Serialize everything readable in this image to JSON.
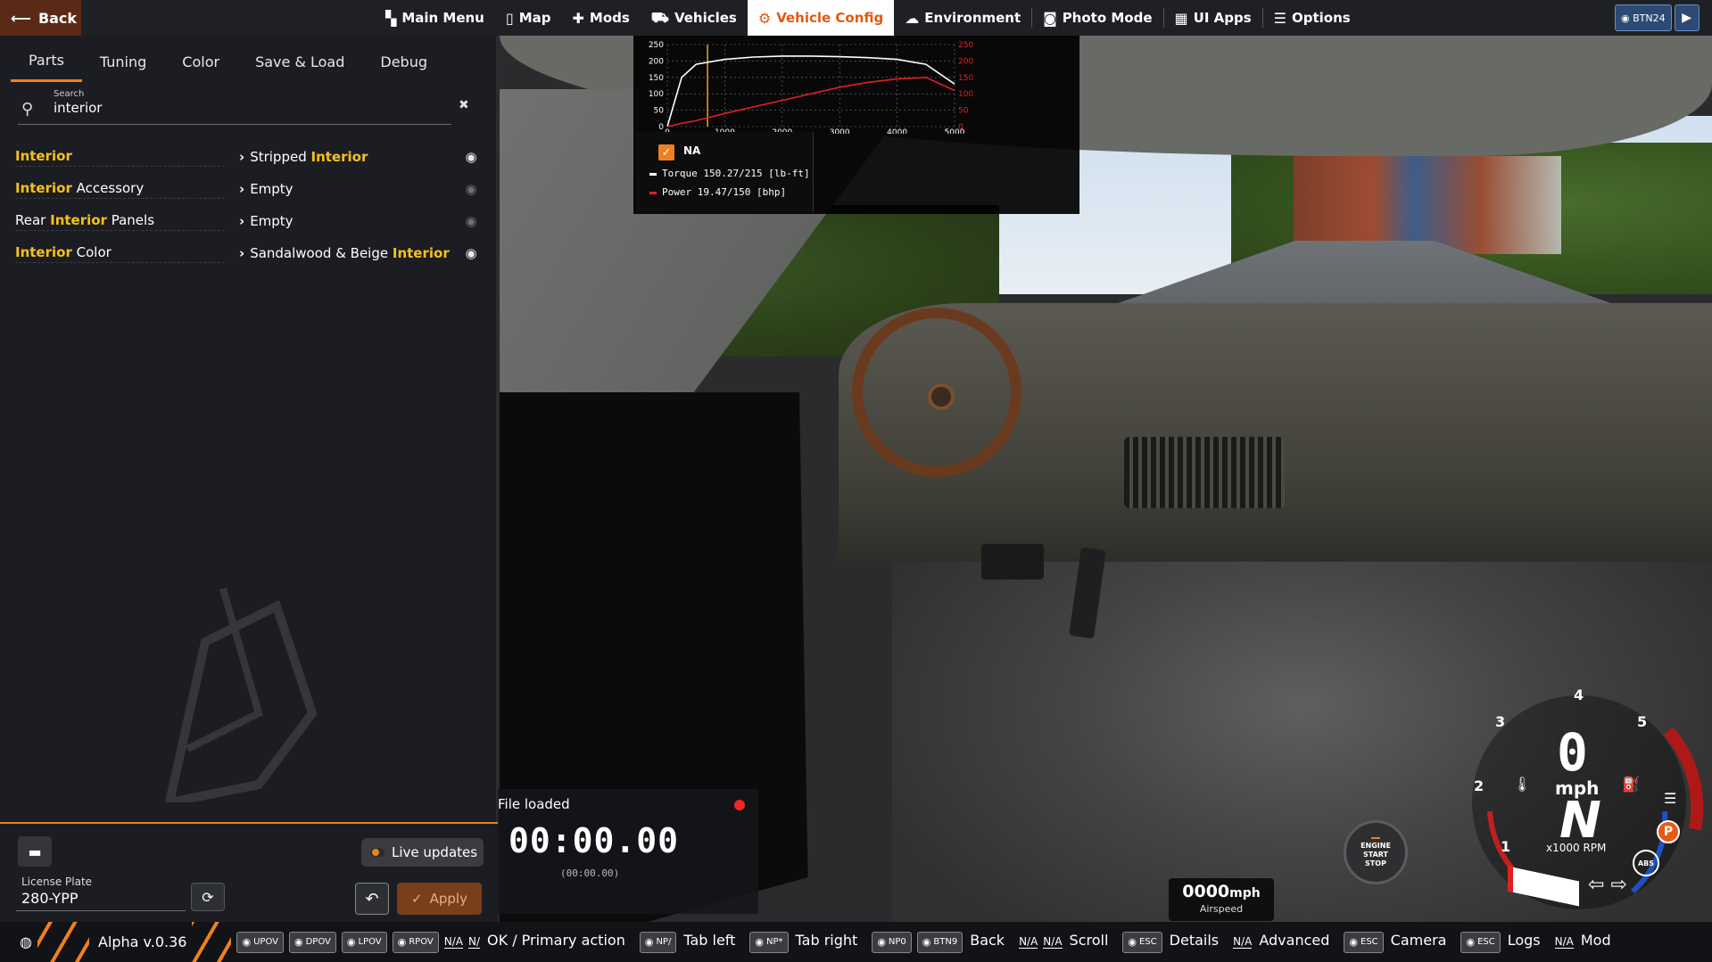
{
  "topbar": {
    "back_label": "Back",
    "nav": [
      {
        "label": "Main Menu",
        "icon": "▚"
      },
      {
        "label": "Map",
        "icon": "▯"
      },
      {
        "label": "Mods",
        "icon": "✚"
      },
      {
        "label": "Vehicles",
        "icon": "⛟"
      },
      {
        "label": "Vehicle Config",
        "icon": "⚙"
      },
      {
        "label": "Environment",
        "icon": "☁"
      },
      {
        "label": "Photo Mode",
        "icon": "◙"
      },
      {
        "label": "UI Apps",
        "icon": "▦"
      },
      {
        "label": "Options",
        "icon": "☰"
      }
    ],
    "active_index": 4,
    "controller_chip": "BTN24",
    "accent": "#f07f1f"
  },
  "panel": {
    "tabs": [
      "Parts",
      "Tuning",
      "Color",
      "Save & Load",
      "Debug"
    ],
    "active_tab": "Parts",
    "search": {
      "label": "Search",
      "value": "interior"
    },
    "parts": [
      {
        "name_pre": "",
        "name_hl": "Interior",
        "name_post": "",
        "val_pre": "Stripped ",
        "val_hl": "Interior",
        "visible": true
      },
      {
        "name_pre": "",
        "name_hl": "Interior",
        "name_post": " Accessory",
        "val_pre": "Empty",
        "val_hl": "",
        "visible": false
      },
      {
        "name_pre": "Rear ",
        "name_hl": "Interior",
        "name_post": " Panels",
        "val_pre": "Empty",
        "val_hl": "",
        "visible": false
      },
      {
        "name_pre": "",
        "name_hl": "Interior",
        "name_post": " Color",
        "val_pre": "Sandalwood & Beige ",
        "val_hl": "Interior",
        "visible": true
      }
    ],
    "license_plate_label": "License Plate",
    "license_plate_value": "280-YPP",
    "live_updates_label": "Live updates",
    "apply_label": "Apply"
  },
  "graph": {
    "na_label": "NA",
    "torque_legend": "Torque 150.27/215 [lb-ft]",
    "power_legend": "Power  19.47/150  [bhp]",
    "torque_color": "#ffffff",
    "power_color": "#e02020",
    "marker_color": "#f0a020"
  },
  "chart_data": {
    "type": "line",
    "x": [
      0,
      250,
      500,
      1000,
      1500,
      2000,
      2500,
      3000,
      3500,
      4000,
      4500,
      5000
    ],
    "x_ticks": [
      "0",
      "1000",
      "2000",
      "3000",
      "4000",
      "5000"
    ],
    "y_ticks_left": [
      "0",
      "50",
      "100",
      "150",
      "200",
      "250"
    ],
    "y_ticks_right": [
      "0",
      "50",
      "100",
      "150",
      "200",
      "250"
    ],
    "ylim": [
      0,
      250
    ],
    "xlim": [
      0,
      5000
    ],
    "series": [
      {
        "name": "Torque",
        "values": [
          0,
          150,
          190,
          205,
          212,
          215,
          215,
          213,
          210,
          205,
          190,
          130
        ]
      },
      {
        "name": "Power",
        "values": [
          0,
          10,
          18,
          40,
          60,
          80,
          100,
          120,
          135,
          145,
          150,
          110
        ]
      }
    ],
    "marker_x": 700
  },
  "timer": {
    "status": "File loaded",
    "time": "00:00.00",
    "sub_time": "(00:00.00)"
  },
  "hud": {
    "start_stop_lines": [
      "ENGINE",
      "START",
      "STOP"
    ],
    "airspeed_value": "0000",
    "airspeed_unit": "mph",
    "airspeed_label": "Airspeed",
    "speed": "0",
    "speed_unit": "mph",
    "gear": "N",
    "rpm_label": "x1000 RPM",
    "gauge_numbers": [
      "1",
      "2",
      "3",
      "4",
      "5"
    ],
    "park_label": "P",
    "abs_label": "ABS"
  },
  "bottombar": {
    "version": "Alpha v.0.36",
    "items": [
      {
        "keys": [
          "UPOV"
        ],
        "label": ""
      },
      {
        "keys": [
          "DPOV"
        ],
        "label": ""
      },
      {
        "keys": [
          "LPOV"
        ],
        "label": ""
      },
      {
        "keys": [
          "RPOV"
        ],
        "label": ""
      },
      {
        "keys": [
          "N/A",
          "N/"
        ],
        "label": "OK / Primary action"
      },
      {
        "keys": [
          "NP/"
        ],
        "label": "Tab left"
      },
      {
        "keys": [
          "NP*"
        ],
        "label": "Tab right"
      },
      {
        "keys": [
          "NP0",
          "BTN9"
        ],
        "label": "Back"
      },
      {
        "keys": [
          "N/A",
          "N/A"
        ],
        "label": "Scroll"
      },
      {
        "keys": [
          "ESC"
        ],
        "label": "Details"
      },
      {
        "keys": [
          "N/A"
        ],
        "label": "Advanced"
      },
      {
        "keys": [
          "ESC"
        ],
        "label": "Camera"
      },
      {
        "keys": [
          "ESC"
        ],
        "label": "Logs"
      },
      {
        "keys": [
          "N/A"
        ],
        "label": "Mod"
      }
    ]
  }
}
